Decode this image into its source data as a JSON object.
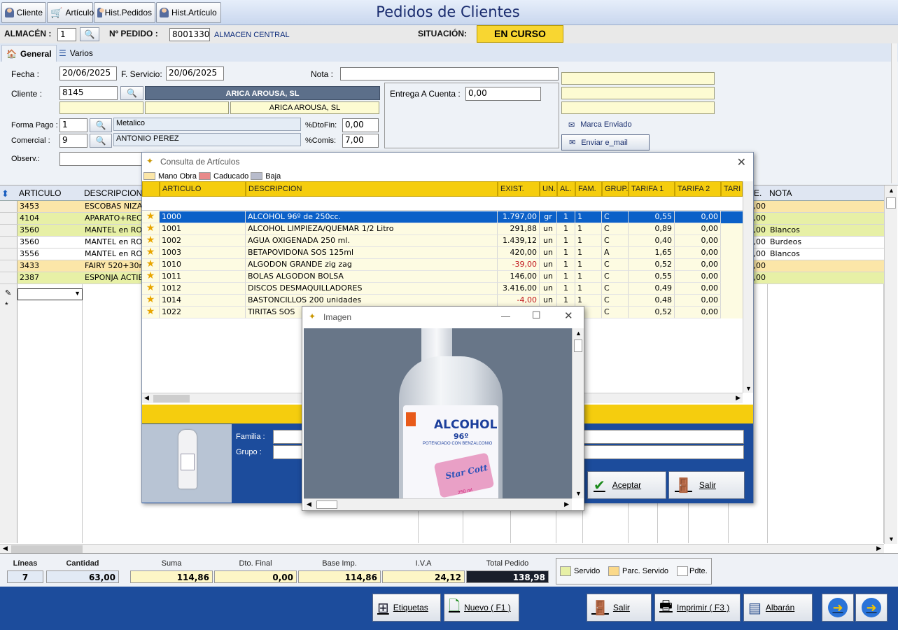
{
  "toolbar": {
    "cliente": "Cliente",
    "articulo": "Artículo",
    "hist_pedidos": "Hist.Pedidos",
    "hist_articulo": "Hist.Artículo"
  },
  "title": "Pedidos de Clientes",
  "header": {
    "almacen_label": "ALMACÉN :",
    "almacen_value": "1",
    "pedido_label": "Nº PEDIDO :",
    "pedido_value": "8001330",
    "almacen_name": "ALMACEN CENTRAL",
    "situacion_label": "SITUACIÓN:",
    "situacion_value": "EN CURSO"
  },
  "tabs": {
    "general": "General",
    "varios": "Varios"
  },
  "form": {
    "fecha_label": "Fecha :",
    "fecha": "20/06/2025",
    "fservicio_label": "F. Servicio:",
    "fservicio": "20/06/2025",
    "nota_label": "Nota :",
    "nota": "",
    "cliente_label": "Cliente :",
    "cliente_code": "8145",
    "cliente_name": "ARICA AROUSA, SL",
    "cliente_name2": "ARICA AROUSA, SL",
    "entrega_label": "Entrega A Cuenta :",
    "entrega": "0,00",
    "formapago_label": "Forma Pago :",
    "formapago_code": "1",
    "formapago_name": "Metalico",
    "comercial_label": "Comercial :",
    "comercial_code": "9",
    "comercial_name": "ANTONIO PEREZ",
    "dtofin_label": "%DtoFin:",
    "dtofin": "0,00",
    "comis_label": "%Comis:",
    "comis": "7,00",
    "observ_label": "Observ.:",
    "marca_enviado": "Marca Enviado",
    "enviar_email": "Enviar e_mail"
  },
  "grid": {
    "headers": [
      "ARTICULO",
      "DESCRIPCION",
      "NOTA"
    ],
    "rows": [
      {
        "articulo": "3453",
        "desc": "ESCOBAS NIZA B",
        "end": ",00",
        "nota": "",
        "color": "#fbe6a8"
      },
      {
        "articulo": "4104",
        "desc": "APARATO+RECA",
        "end": ",00",
        "nota": "",
        "color": "#e7f0a6"
      },
      {
        "articulo": "3560",
        "desc": "MANTEL en ROLL",
        "end": ",00",
        "nota": "Blancos",
        "color": "#e7f0a6"
      },
      {
        "articulo": "3560",
        "desc": "MANTEL en ROLL",
        "end": "2,00",
        "nota": "Burdeos",
        "color": "#ffffff"
      },
      {
        "articulo": "3556",
        "desc": "MANTEL en ROLL",
        "end": "4,00",
        "nota": "Blancos",
        "color": "#ffffff"
      },
      {
        "articulo": "3433",
        "desc": "FAIRY 520+30ml",
        "end": ",00",
        "nota": "",
        "color": "#fbe6a8"
      },
      {
        "articulo": "2387",
        "desc": "ESPONJA ACTIBE",
        "end": ",00",
        "nota": "",
        "color": "#e7f0a6"
      }
    ]
  },
  "dialog": {
    "title": "Consulta de Artículos",
    "legend": [
      {
        "label": "Mano Obra",
        "color": "#fbe6a8"
      },
      {
        "label": "Caducado",
        "color": "#e88a8a"
      },
      {
        "label": "Baja",
        "color": "#b8bccc"
      }
    ],
    "headers": [
      "ARTICULO",
      "DESCRIPCION",
      "EXIST.",
      "UN.",
      "AL.",
      "FAM.",
      "GRUP.",
      "TARIFA 1",
      "TARIFA 2",
      "TARI"
    ],
    "rows": [
      {
        "art": "1000",
        "desc": "ALCOHOL 96º de 250cc.",
        "exist": "1.797,00",
        "un": "gr",
        "al": "1",
        "fam": "1",
        "grup": "C",
        "t1": "0,55",
        "t2": "0,00",
        "neg": false
      },
      {
        "art": "1001",
        "desc": "ALCOHOL LIMPIEZA/QUEMAR 1/2 Litro",
        "exist": "291,88",
        "un": "un",
        "al": "1",
        "fam": "1",
        "grup": "C",
        "t1": "0,89",
        "t2": "0,00",
        "neg": false
      },
      {
        "art": "1002",
        "desc": "AGUA OXIGENADA 250 ml.",
        "exist": "1.439,12",
        "un": "un",
        "al": "1",
        "fam": "1",
        "grup": "C",
        "t1": "0,40",
        "t2": "0,00",
        "neg": false
      },
      {
        "art": "1003",
        "desc": "BETAPOVIDONA SOS 125ml",
        "exist": "420,00",
        "un": "un",
        "al": "1",
        "fam": "1",
        "grup": "A",
        "t1": "1,65",
        "t2": "0,00",
        "neg": false
      },
      {
        "art": "1010",
        "desc": "ALGODON GRANDE zig zag",
        "exist": "-39,00",
        "un": "un",
        "al": "1",
        "fam": "1",
        "grup": "C",
        "t1": "0,52",
        "t2": "0,00",
        "neg": true
      },
      {
        "art": "1011",
        "desc": "BOLAS ALGODON BOLSA",
        "exist": "146,00",
        "un": "un",
        "al": "1",
        "fam": "1",
        "grup": "C",
        "t1": "0,55",
        "t2": "0,00",
        "neg": false
      },
      {
        "art": "1012",
        "desc": "DISCOS DESMAQUILLADORES",
        "exist": "3.416,00",
        "un": "un",
        "al": "1",
        "fam": "1",
        "grup": "C",
        "t1": "0,49",
        "t2": "0,00",
        "neg": false
      },
      {
        "art": "1014",
        "desc": "BASTONCILLOS 200 unidades",
        "exist": "-4,00",
        "un": "un",
        "al": "1",
        "fam": "1",
        "grup": "C",
        "t1": "0,48",
        "t2": "0,00",
        "neg": true
      },
      {
        "art": "1022",
        "desc": "TIRITAS SOS",
        "exist": "",
        "un": "",
        "al": "",
        "fam": "",
        "grup": "C",
        "t1": "0,52",
        "t2": "0,00",
        "neg": false
      }
    ],
    "familia_label": "Familia :",
    "grupo_label": "Grupo :",
    "aceptar": "Aceptar",
    "salir": "Salir"
  },
  "image_window": {
    "title": "Imagen",
    "label_text": "ALCOHOL",
    "label_sub": "96º",
    "label_small": "POTENCIADO CON BENZALCONIO",
    "brand": "Star Cott",
    "volume": "250 ml"
  },
  "summary": {
    "lineas_label": "Líneas",
    "lineas": "7",
    "cantidad_label": "Cantidad",
    "cantidad": "63,00",
    "suma_label": "Suma",
    "suma": "114,86",
    "dto_label": "Dto. Final",
    "dto": "0,00",
    "base_label": "Base Imp.",
    "base": "114,86",
    "iva_label": "I.V.A",
    "iva": "24,12",
    "total_label": "Total Pedido",
    "total": "138,98",
    "legend_servido": "Servido",
    "legend_parc": "Parc. Servido",
    "legend_pdte": "Pdte."
  },
  "footer": {
    "etiquetas": "Etiquetas",
    "nuevo": "Nuevo ( F1 )",
    "salir": "Salir",
    "imprimir": "Imprimir ( F3 )",
    "albaran": "Albarán"
  },
  "colors": {
    "accent_yellow": "#f5cd0e",
    "footer_blue": "#1c4c9c",
    "selected_row": "#0b60c8"
  }
}
